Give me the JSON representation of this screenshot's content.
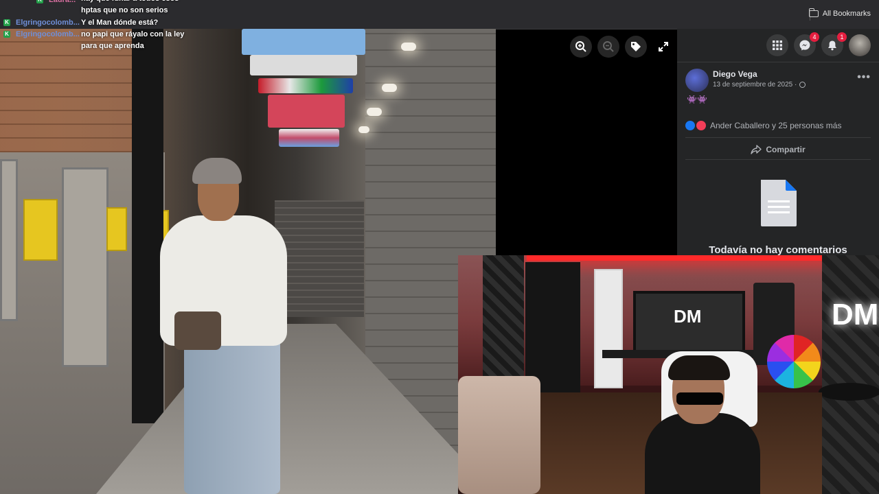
{
  "browser": {
    "bookmarks_label": "All Bookmarks"
  },
  "chat": {
    "messages": [
      {
        "user": "Laura...",
        "text": "hay que funar a todos esos hptas que no son serios"
      },
      {
        "user": "Elgringocolomb...",
        "text": "Y el Man dónde está?"
      },
      {
        "user": "Elgringocolomb...",
        "text": "no papi que ráyalo con la ley para que aprenda"
      }
    ]
  },
  "viewer": {
    "tools": [
      "zoom-in-icon",
      "zoom-out-icon",
      "tag-icon",
      "fullscreen-icon"
    ]
  },
  "fb_header": {
    "messenger_badge": "4",
    "notifications_badge": "1"
  },
  "post": {
    "author": "Diego Vega",
    "date": "13 de septiembre de 2025 ·",
    "text": "👾👾",
    "reactions": "Ander Caballero y 25 personas más",
    "share_label": "Compartir",
    "no_comments": "Todavía no hay comentarios"
  },
  "colors": {
    "fb_bg": "#242526",
    "badge_red": "#e41e3f",
    "like_blue": "#1877f2"
  }
}
